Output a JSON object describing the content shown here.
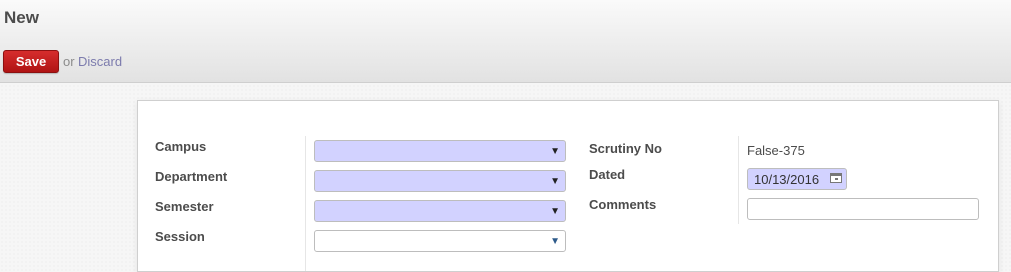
{
  "header": {
    "title": "New",
    "save_label": "Save",
    "or_text": "or",
    "discard_label": "Discard"
  },
  "form": {
    "left": {
      "campus": {
        "label": "Campus",
        "value": ""
      },
      "department": {
        "label": "Department",
        "value": ""
      },
      "semester": {
        "label": "Semester",
        "value": ""
      },
      "session": {
        "label": "Session",
        "value": ""
      }
    },
    "right": {
      "scrutiny_no": {
        "label": "Scrutiny No",
        "value": "False-375"
      },
      "dated": {
        "label": "Dated",
        "value": "10/13/2016"
      },
      "comments": {
        "label": "Comments",
        "value": ""
      }
    }
  },
  "icons": {
    "dropdown_arrow": "chevron-down-icon",
    "calendar": "calendar-icon"
  },
  "colors": {
    "save_button": "#c01e1e",
    "discard_link": "#7c7bad",
    "required_field_bg": "#d2d2ff"
  }
}
